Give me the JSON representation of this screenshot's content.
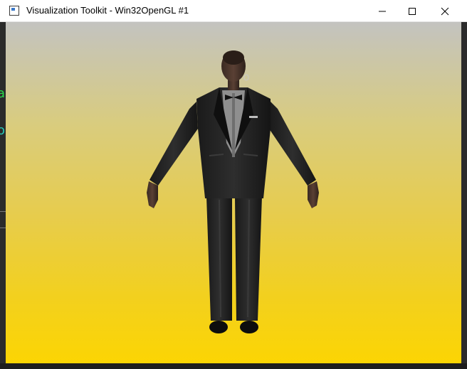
{
  "window": {
    "title": "Visualization Toolkit - Win32OpenGL #1",
    "controls": {
      "minimize": "minimize-icon",
      "maximize": "maximize-icon",
      "close": "close-icon"
    }
  },
  "viewport": {
    "gradient_top": "#c3c3c0",
    "gradient_bottom": "#fcd503",
    "scene": "3d-human-character-in-black-suit-a-pose"
  },
  "background_window_fragments": [
    "a",
    "o"
  ]
}
